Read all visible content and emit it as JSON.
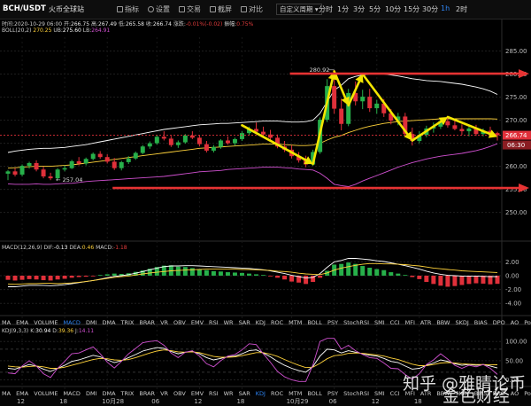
{
  "header": {
    "pair": "BCH/USDT",
    "exchange": "火币全球站",
    "toolbar": [
      {
        "label": "指标",
        "icon": "indicator-icon"
      },
      {
        "label": "设置",
        "icon": "gear-icon"
      },
      {
        "label": "交易",
        "icon": "trade-icon"
      },
      {
        "label": "截屏",
        "icon": "camera-icon"
      },
      {
        "label": "对比",
        "icon": "compare-icon"
      }
    ],
    "interval_select": "自定义周期 ▾",
    "intervals": [
      "分时",
      "1分",
      "3分",
      "5分",
      "10分",
      "15分",
      "30分",
      "1h",
      "2时"
    ],
    "active_interval": "1h"
  },
  "ohlc": {
    "date": "时间:2020-10-29 06:00",
    "open_label": "开:",
    "open": "266.75",
    "high_label": "高:",
    "high": "267.49",
    "low_label": "低:",
    "low": "265.58",
    "close_label": "收:",
    "close": "266.74",
    "change_label": "涨跌:",
    "change": "-0.01%(-0.02)",
    "amplitude_label": "振幅:",
    "amplitude": "0.75%"
  },
  "boll": {
    "name": "BOLL(20,2)",
    "mid": "270.25",
    "upper_label": "UB:",
    "upper": "275.60",
    "lower_label": "LB:",
    "lower": "264.91"
  },
  "macd_header": {
    "name": "MACD(12,26,9)",
    "dif_label": "DIF:",
    "dif": "-0.13",
    "dea_label": "DEA:",
    "dea": "0.46",
    "macd_label": "MACD:",
    "macd": "-1.18"
  },
  "kdj_header": {
    "name": "KDJ(9,3,3)",
    "k_label": "K:",
    "k": "30.94",
    "d_label": "D:",
    "d": "39.36",
    "j_label": "J:",
    "j": "14.11"
  },
  "indicator_tabs": [
    "MA",
    "EMA",
    "VOLUME",
    "MACD",
    "DMI",
    "DMA",
    "TRIX",
    "BRAR",
    "VR",
    "OBV",
    "EMV",
    "RSI",
    "WR",
    "SAR",
    "KDJ",
    "ROC",
    "MTM",
    "BOLL",
    "PSY",
    "StochRSI",
    "SMI",
    "CCI",
    "MFI",
    "ATR",
    "BBW",
    "SKDJ",
    "BIAS",
    "DPO",
    "AO",
    "Position"
  ],
  "active_tabs_row1": "MACD",
  "active_tabs_row2": "KDJ",
  "watermark": {
    "line1": "知乎 @雅睛论币",
    "line2": "金色财经"
  },
  "colors": {
    "up": "#27b04a",
    "down": "#e0303a",
    "arrow_yellow": "#f3e500",
    "arrow_red": "#e63333",
    "price_tag": "#e0303a",
    "boll_upper": "#ffffff",
    "boll_mid": "#ffd23a",
    "boll_lower": "#d050d0",
    "dif": "#ffffff",
    "dea": "#ffd23a",
    "j_line": "#d050d0"
  },
  "chart_data": [
    {
      "type": "candlestick",
      "panel": "main",
      "yticks": [
        250.0,
        255.0,
        260.0,
        265.0,
        270.0,
        275.0,
        280.0,
        285.0
      ],
      "ylim": [
        248,
        288
      ],
      "xticks": [
        "12",
        "18",
        "10月28",
        "06",
        "12",
        "18",
        "10月29",
        "06",
        "12",
        "18"
      ],
      "current_price": "266.74",
      "countdown": "06:30",
      "high_annotation": "280.92",
      "low_annotation": "257.04",
      "candles": [
        [
          258.4,
          259.2,
          257.0,
          258.9
        ],
        [
          258.9,
          259.6,
          257.8,
          258.2
        ],
        [
          258.2,
          260.4,
          257.8,
          260.1
        ],
        [
          260.1,
          261.0,
          259.5,
          260.7
        ],
        [
          260.7,
          261.3,
          258.9,
          259.3
        ],
        [
          259.3,
          259.9,
          257.4,
          257.8
        ],
        [
          257.8,
          258.6,
          257.0,
          257.4
        ],
        [
          257.4,
          259.6,
          257.2,
          259.3
        ],
        [
          259.3,
          260.2,
          258.9,
          259.6
        ],
        [
          259.6,
          261.4,
          259.4,
          261.1
        ],
        [
          261.1,
          262.0,
          260.2,
          260.6
        ],
        [
          260.6,
          261.9,
          260.2,
          261.6
        ],
        [
          261.6,
          263.0,
          261.3,
          262.7
        ],
        [
          262.7,
          263.3,
          261.6,
          262.0
        ],
        [
          262.0,
          262.6,
          260.6,
          261.0
        ],
        [
          261.0,
          261.8,
          259.2,
          259.6
        ],
        [
          259.6,
          261.2,
          259.1,
          260.9
        ],
        [
          260.9,
          262.2,
          260.5,
          261.7
        ],
        [
          261.7,
          263.2,
          261.4,
          262.9
        ],
        [
          262.9,
          264.6,
          262.6,
          264.3
        ],
        [
          264.3,
          265.4,
          263.8,
          265.0
        ],
        [
          265.0,
          266.8,
          264.7,
          266.4
        ],
        [
          266.4,
          267.6,
          265.6,
          266.0
        ],
        [
          266.0,
          266.6,
          264.2,
          264.6
        ],
        [
          264.6,
          265.6,
          264.0,
          265.2
        ],
        [
          265.2,
          267.0,
          264.9,
          266.7
        ],
        [
          266.7,
          267.6,
          265.9,
          266.2
        ],
        [
          266.2,
          266.8,
          264.3,
          264.8
        ],
        [
          264.8,
          265.5,
          263.0,
          263.4
        ],
        [
          263.4,
          264.6,
          263.0,
          264.2
        ],
        [
          264.2,
          265.9,
          263.8,
          265.6
        ],
        [
          265.6,
          266.5,
          264.7,
          265.0
        ],
        [
          265.0,
          266.2,
          264.5,
          265.9
        ],
        [
          265.9,
          267.6,
          265.5,
          267.2
        ],
        [
          267.2,
          268.6,
          266.7,
          268.1
        ],
        [
          268.1,
          269.5,
          267.2,
          267.5
        ],
        [
          267.5,
          268.6,
          266.5,
          266.9
        ],
        [
          266.9,
          267.9,
          265.7,
          266.2
        ],
        [
          266.2,
          266.9,
          263.9,
          264.3
        ],
        [
          264.3,
          265.5,
          263.1,
          263.6
        ],
        [
          263.6,
          264.6,
          261.7,
          262.2
        ],
        [
          262.2,
          263.1,
          260.8,
          261.3
        ],
        [
          261.3,
          262.3,
          259.8,
          260.4
        ],
        [
          260.4,
          263.6,
          260.1,
          263.1
        ],
        [
          263.1,
          270.6,
          262.7,
          270.1
        ],
        [
          270.1,
          278.9,
          269.6,
          277.4
        ],
        [
          277.4,
          280.9,
          271.4,
          272.5
        ],
        [
          272.5,
          274.7,
          267.8,
          269.2
        ],
        [
          269.2,
          276.8,
          268.7,
          275.9
        ],
        [
          275.9,
          278.4,
          273.2,
          274.1
        ],
        [
          274.1,
          276.6,
          272.4,
          275.1
        ],
        [
          275.1,
          276.8,
          271.8,
          272.6
        ],
        [
          272.6,
          274.4,
          271.4,
          273.6
        ],
        [
          273.6,
          274.6,
          270.7,
          271.5
        ],
        [
          271.5,
          272.4,
          269.1,
          269.9
        ],
        [
          269.9,
          271.6,
          268.9,
          270.8
        ],
        [
          270.8,
          271.6,
          266.4,
          267.0
        ],
        [
          267.0,
          268.4,
          264.5,
          265.5
        ],
        [
          265.5,
          267.6,
          265.0,
          266.8
        ],
        [
          266.8,
          268.8,
          266.3,
          268.2
        ],
        [
          268.2,
          269.5,
          267.3,
          268.6
        ],
        [
          268.6,
          270.4,
          268.1,
          269.8
        ],
        [
          269.8,
          270.7,
          268.4,
          268.9
        ],
        [
          268.9,
          270.0,
          267.8,
          268.1
        ],
        [
          268.1,
          269.1,
          266.8,
          267.6
        ],
        [
          267.6,
          268.6,
          266.5,
          268.2
        ],
        [
          268.2,
          269.0,
          266.6,
          267.0
        ],
        [
          267.0,
          268.2,
          266.5,
          267.7
        ],
        [
          267.7,
          268.6,
          266.7,
          267.2
        ],
        [
          267.2,
          267.49,
          265.58,
          266.74
        ]
      ],
      "boll_upper": [
        263.0,
        263.3,
        263.5,
        263.7,
        263.8,
        263.9,
        263.9,
        264.0,
        264.1,
        264.3,
        264.5,
        264.7,
        265.0,
        265.3,
        265.6,
        265.9,
        266.2,
        266.5,
        266.8,
        267.1,
        267.4,
        267.7,
        268.0,
        268.2,
        268.4,
        268.6,
        268.8,
        269.0,
        269.1,
        269.2,
        269.3,
        269.3,
        269.4,
        269.5,
        269.6,
        269.7,
        269.8,
        269.8,
        269.8,
        269.7,
        269.6,
        269.6,
        269.7,
        270.0,
        271.5,
        274.0,
        276.5,
        277.6,
        279.0,
        279.5,
        279.8,
        280.0,
        280.0,
        280.0,
        279.8,
        279.6,
        279.3,
        279.0,
        278.8,
        278.6,
        278.5,
        278.4,
        278.2,
        278.0,
        277.8,
        277.5,
        277.2,
        276.8,
        276.3,
        275.6
      ],
      "boll_mid": [
        259.6,
        259.7,
        259.8,
        259.9,
        260.0,
        260.0,
        260.0,
        260.1,
        260.2,
        260.3,
        260.5,
        260.7,
        260.9,
        261.1,
        261.3,
        261.5,
        261.7,
        261.9,
        262.1,
        262.3,
        262.5,
        262.7,
        262.9,
        263.1,
        263.3,
        263.5,
        263.7,
        263.9,
        264.0,
        264.1,
        264.2,
        264.3,
        264.4,
        264.5,
        264.6,
        264.7,
        264.8,
        264.8,
        264.8,
        264.7,
        264.6,
        264.5,
        264.5,
        264.6,
        265.0,
        265.7,
        266.3,
        266.7,
        267.3,
        267.8,
        268.3,
        268.7,
        269.0,
        269.3,
        269.5,
        269.7,
        269.8,
        269.9,
        270.0,
        270.1,
        270.2,
        270.3,
        270.3,
        270.3,
        270.3,
        270.3,
        270.3,
        270.3,
        270.3,
        270.25
      ],
      "boll_lower": [
        256.2,
        256.1,
        256.1,
        256.1,
        256.2,
        256.1,
        256.1,
        256.2,
        256.3,
        256.3,
        256.5,
        256.7,
        256.8,
        256.9,
        257.0,
        257.1,
        257.2,
        257.3,
        257.4,
        257.5,
        257.6,
        257.7,
        257.8,
        258.0,
        258.2,
        258.4,
        258.6,
        258.8,
        258.9,
        259.0,
        259.1,
        259.3,
        259.4,
        259.5,
        259.6,
        259.7,
        259.8,
        259.8,
        259.8,
        259.7,
        259.6,
        259.4,
        259.3,
        259.2,
        258.5,
        257.4,
        256.1,
        255.8,
        255.6,
        256.1,
        256.8,
        257.4,
        258.0,
        258.6,
        259.2,
        259.8,
        260.3,
        260.8,
        261.2,
        261.6,
        261.9,
        262.2,
        262.4,
        262.6,
        262.8,
        263.1,
        263.4,
        263.8,
        264.3,
        264.91
      ],
      "annotations": {
        "yellow_arrows": [
          {
            "from": [
              33,
              268.9
            ],
            "to": [
              43,
              260.5
            ]
          },
          {
            "from": [
              43,
              260.5
            ],
            "to": [
              46,
              280.6
            ]
          },
          {
            "from": [
              46,
              280.6
            ],
            "to": [
              48,
              273.2
            ]
          },
          {
            "from": [
              48,
              273.2
            ],
            "to": [
              50,
              280.0
            ]
          },
          {
            "from": [
              50,
              280.0
            ],
            "to": [
              57,
              265.6
            ]
          },
          {
            "from": [
              57,
              265.6
            ],
            "to": [
              62,
              270.7
            ]
          },
          {
            "from": [
              62,
              270.7
            ],
            "to": [
              69,
              266.4
            ]
          }
        ],
        "red_lines": [
          {
            "y": 280.1,
            "from": 40,
            "to": 70
          },
          {
            "y": 255.3,
            "from": 15,
            "to": 70
          }
        ]
      }
    },
    {
      "type": "bar",
      "panel": "macd",
      "yticks": [
        -4.0,
        -2.0,
        0.0,
        2.0
      ],
      "ylim": [
        -5,
        3.2
      ],
      "histogram": [
        -0.6,
        -0.7,
        -0.6,
        -0.5,
        -0.55,
        -0.65,
        -0.7,
        -0.55,
        -0.45,
        -0.3,
        -0.2,
        -0.15,
        -0.1,
        0.1,
        0.2,
        0.3,
        0.25,
        0.35,
        0.55,
        0.75,
        1.0,
        1.25,
        1.45,
        1.5,
        1.3,
        1.25,
        1.1,
        0.95,
        0.8,
        0.65,
        0.6,
        0.5,
        0.45,
        0.4,
        0.3,
        0.2,
        0.1,
        -0.1,
        -0.3,
        -0.55,
        -0.85,
        -1.0,
        -1.2,
        -0.9,
        -0.3,
        0.7,
        1.6,
        1.7,
        1.9,
        1.7,
        1.4,
        1.15,
        0.95,
        0.8,
        0.5,
        0.3,
        0.1,
        -0.2,
        -0.5,
        -0.9,
        -1.2,
        -1.45,
        -1.6,
        -1.5,
        -1.35,
        -1.2,
        -1.1,
        -1.15,
        -1.25,
        -1.18
      ],
      "dif": [
        -1.6,
        -1.6,
        -1.5,
        -1.4,
        -1.4,
        -1.4,
        -1.45,
        -1.4,
        -1.3,
        -1.15,
        -1.0,
        -0.85,
        -0.7,
        -0.5,
        -0.3,
        -0.1,
        0.0,
        0.15,
        0.35,
        0.6,
        0.85,
        1.1,
        1.3,
        1.4,
        1.4,
        1.45,
        1.45,
        1.4,
        1.35,
        1.3,
        1.25,
        1.2,
        1.15,
        1.1,
        1.05,
        0.95,
        0.85,
        0.7,
        0.5,
        0.3,
        0.05,
        -0.15,
        -0.35,
        -0.25,
        0.3,
        1.2,
        2.0,
        2.2,
        2.5,
        2.5,
        2.4,
        2.3,
        2.15,
        2.05,
        1.85,
        1.65,
        1.45,
        1.2,
        0.95,
        0.65,
        0.4,
        0.2,
        0.05,
        0.0,
        -0.05,
        -0.05,
        -0.05,
        -0.1,
        -0.15,
        -0.13
      ],
      "dea": [
        -1.2,
        -1.25,
        -1.2,
        -1.15,
        -1.15,
        -1.1,
        -1.1,
        -1.15,
        -1.1,
        -1.05,
        -0.95,
        -0.85,
        -0.7,
        -0.55,
        -0.4,
        -0.25,
        -0.15,
        -0.05,
        0.1,
        0.25,
        0.4,
        0.5,
        0.6,
        0.7,
        0.75,
        0.8,
        0.85,
        0.9,
        0.95,
        0.95,
        0.95,
        0.95,
        0.95,
        0.9,
        0.9,
        0.85,
        0.8,
        0.75,
        0.65,
        0.6,
        0.5,
        0.35,
        0.25,
        0.2,
        0.15,
        0.4,
        0.8,
        1.1,
        1.3,
        1.5,
        1.65,
        1.75,
        1.75,
        1.7,
        1.7,
        1.65,
        1.6,
        1.5,
        1.4,
        1.25,
        1.1,
        1.0,
        0.9,
        0.8,
        0.7,
        0.65,
        0.6,
        0.55,
        0.5,
        0.46
      ]
    },
    {
      "type": "line",
      "panel": "kdj",
      "yticks": [
        0,
        50,
        100
      ],
      "ylim": [
        -8,
        112
      ],
      "k": [
        30,
        28,
        34,
        40,
        36,
        28,
        22,
        30,
        38,
        48,
        52,
        58,
        64,
        60,
        52,
        45,
        50,
        58,
        66,
        75,
        80,
        84,
        82,
        74,
        68,
        72,
        74,
        68,
        58,
        52,
        56,
        60,
        62,
        68,
        76,
        78,
        70,
        60,
        48,
        38,
        30,
        24,
        20,
        35,
        62,
        80,
        78,
        70,
        76,
        72,
        68,
        64,
        62,
        56,
        48,
        45,
        36,
        28,
        30,
        38,
        44,
        52,
        48,
        42,
        38,
        40,
        38,
        40,
        36,
        30.94
      ],
      "d": [
        36,
        34,
        33,
        35,
        36,
        34,
        30,
        30,
        33,
        38,
        43,
        48,
        53,
        56,
        55,
        52,
        51,
        53,
        58,
        64,
        70,
        75,
        78,
        76,
        73,
        72,
        73,
        71,
        66,
        61,
        59,
        59,
        60,
        63,
        67,
        71,
        71,
        67,
        61,
        53,
        45,
        38,
        32,
        33,
        43,
        55,
        63,
        65,
        69,
        70,
        69,
        67,
        65,
        62,
        57,
        53,
        47,
        41,
        37,
        37,
        40,
        44,
        45,
        44,
        42,
        41,
        40,
        40,
        39,
        39.36
      ],
      "j": [
        18,
        16,
        36,
        50,
        36,
        16,
        6,
        30,
        48,
        68,
        70,
        78,
        86,
        68,
        46,
        31,
        48,
        68,
        82,
        97,
        100,
        102,
        90,
        70,
        58,
        72,
        76,
        62,
        42,
        34,
        50,
        62,
        66,
        78,
        94,
        92,
        68,
        46,
        22,
        8,
        0,
        -4,
        -4,
        39,
        100,
        108,
        108,
        80,
        90,
        76,
        66,
        58,
        56,
        44,
        30,
        29,
        14,
        2,
        16,
        40,
        52,
        68,
        54,
        38,
        30,
        38,
        34,
        40,
        30,
        14.11
      ]
    }
  ]
}
